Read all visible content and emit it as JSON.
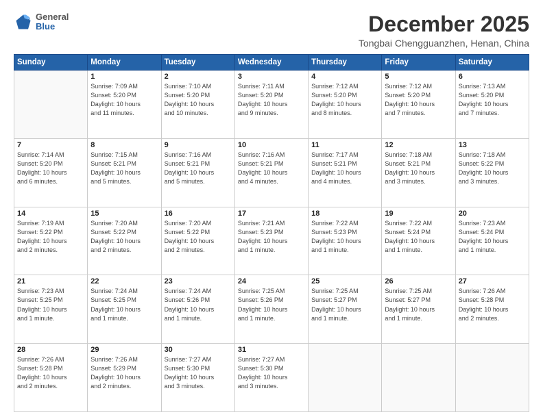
{
  "header": {
    "logo": {
      "general": "General",
      "blue": "Blue"
    },
    "month": "December 2025",
    "location": "Tongbai Chengguanzhen, Henan, China"
  },
  "days_of_week": [
    "Sunday",
    "Monday",
    "Tuesday",
    "Wednesday",
    "Thursday",
    "Friday",
    "Saturday"
  ],
  "weeks": [
    [
      {
        "day": "",
        "info": ""
      },
      {
        "day": "1",
        "info": "Sunrise: 7:09 AM\nSunset: 5:20 PM\nDaylight: 10 hours\nand 11 minutes."
      },
      {
        "day": "2",
        "info": "Sunrise: 7:10 AM\nSunset: 5:20 PM\nDaylight: 10 hours\nand 10 minutes."
      },
      {
        "day": "3",
        "info": "Sunrise: 7:11 AM\nSunset: 5:20 PM\nDaylight: 10 hours\nand 9 minutes."
      },
      {
        "day": "4",
        "info": "Sunrise: 7:12 AM\nSunset: 5:20 PM\nDaylight: 10 hours\nand 8 minutes."
      },
      {
        "day": "5",
        "info": "Sunrise: 7:12 AM\nSunset: 5:20 PM\nDaylight: 10 hours\nand 7 minutes."
      },
      {
        "day": "6",
        "info": "Sunrise: 7:13 AM\nSunset: 5:20 PM\nDaylight: 10 hours\nand 7 minutes."
      }
    ],
    [
      {
        "day": "7",
        "info": "Sunrise: 7:14 AM\nSunset: 5:20 PM\nDaylight: 10 hours\nand 6 minutes."
      },
      {
        "day": "8",
        "info": "Sunrise: 7:15 AM\nSunset: 5:21 PM\nDaylight: 10 hours\nand 5 minutes."
      },
      {
        "day": "9",
        "info": "Sunrise: 7:16 AM\nSunset: 5:21 PM\nDaylight: 10 hours\nand 5 minutes."
      },
      {
        "day": "10",
        "info": "Sunrise: 7:16 AM\nSunset: 5:21 PM\nDaylight: 10 hours\nand 4 minutes."
      },
      {
        "day": "11",
        "info": "Sunrise: 7:17 AM\nSunset: 5:21 PM\nDaylight: 10 hours\nand 4 minutes."
      },
      {
        "day": "12",
        "info": "Sunrise: 7:18 AM\nSunset: 5:21 PM\nDaylight: 10 hours\nand 3 minutes."
      },
      {
        "day": "13",
        "info": "Sunrise: 7:18 AM\nSunset: 5:22 PM\nDaylight: 10 hours\nand 3 minutes."
      }
    ],
    [
      {
        "day": "14",
        "info": "Sunrise: 7:19 AM\nSunset: 5:22 PM\nDaylight: 10 hours\nand 2 minutes."
      },
      {
        "day": "15",
        "info": "Sunrise: 7:20 AM\nSunset: 5:22 PM\nDaylight: 10 hours\nand 2 minutes."
      },
      {
        "day": "16",
        "info": "Sunrise: 7:20 AM\nSunset: 5:22 PM\nDaylight: 10 hours\nand 2 minutes."
      },
      {
        "day": "17",
        "info": "Sunrise: 7:21 AM\nSunset: 5:23 PM\nDaylight: 10 hours\nand 1 minute."
      },
      {
        "day": "18",
        "info": "Sunrise: 7:22 AM\nSunset: 5:23 PM\nDaylight: 10 hours\nand 1 minute."
      },
      {
        "day": "19",
        "info": "Sunrise: 7:22 AM\nSunset: 5:24 PM\nDaylight: 10 hours\nand 1 minute."
      },
      {
        "day": "20",
        "info": "Sunrise: 7:23 AM\nSunset: 5:24 PM\nDaylight: 10 hours\nand 1 minute."
      }
    ],
    [
      {
        "day": "21",
        "info": "Sunrise: 7:23 AM\nSunset: 5:25 PM\nDaylight: 10 hours\nand 1 minute."
      },
      {
        "day": "22",
        "info": "Sunrise: 7:24 AM\nSunset: 5:25 PM\nDaylight: 10 hours\nand 1 minute."
      },
      {
        "day": "23",
        "info": "Sunrise: 7:24 AM\nSunset: 5:26 PM\nDaylight: 10 hours\nand 1 minute."
      },
      {
        "day": "24",
        "info": "Sunrise: 7:25 AM\nSunset: 5:26 PM\nDaylight: 10 hours\nand 1 minute."
      },
      {
        "day": "25",
        "info": "Sunrise: 7:25 AM\nSunset: 5:27 PM\nDaylight: 10 hours\nand 1 minute."
      },
      {
        "day": "26",
        "info": "Sunrise: 7:25 AM\nSunset: 5:27 PM\nDaylight: 10 hours\nand 1 minute."
      },
      {
        "day": "27",
        "info": "Sunrise: 7:26 AM\nSunset: 5:28 PM\nDaylight: 10 hours\nand 2 minutes."
      }
    ],
    [
      {
        "day": "28",
        "info": "Sunrise: 7:26 AM\nSunset: 5:28 PM\nDaylight: 10 hours\nand 2 minutes."
      },
      {
        "day": "29",
        "info": "Sunrise: 7:26 AM\nSunset: 5:29 PM\nDaylight: 10 hours\nand 2 minutes."
      },
      {
        "day": "30",
        "info": "Sunrise: 7:27 AM\nSunset: 5:30 PM\nDaylight: 10 hours\nand 3 minutes."
      },
      {
        "day": "31",
        "info": "Sunrise: 7:27 AM\nSunset: 5:30 PM\nDaylight: 10 hours\nand 3 minutes."
      },
      {
        "day": "",
        "info": ""
      },
      {
        "day": "",
        "info": ""
      },
      {
        "day": "",
        "info": ""
      }
    ]
  ]
}
